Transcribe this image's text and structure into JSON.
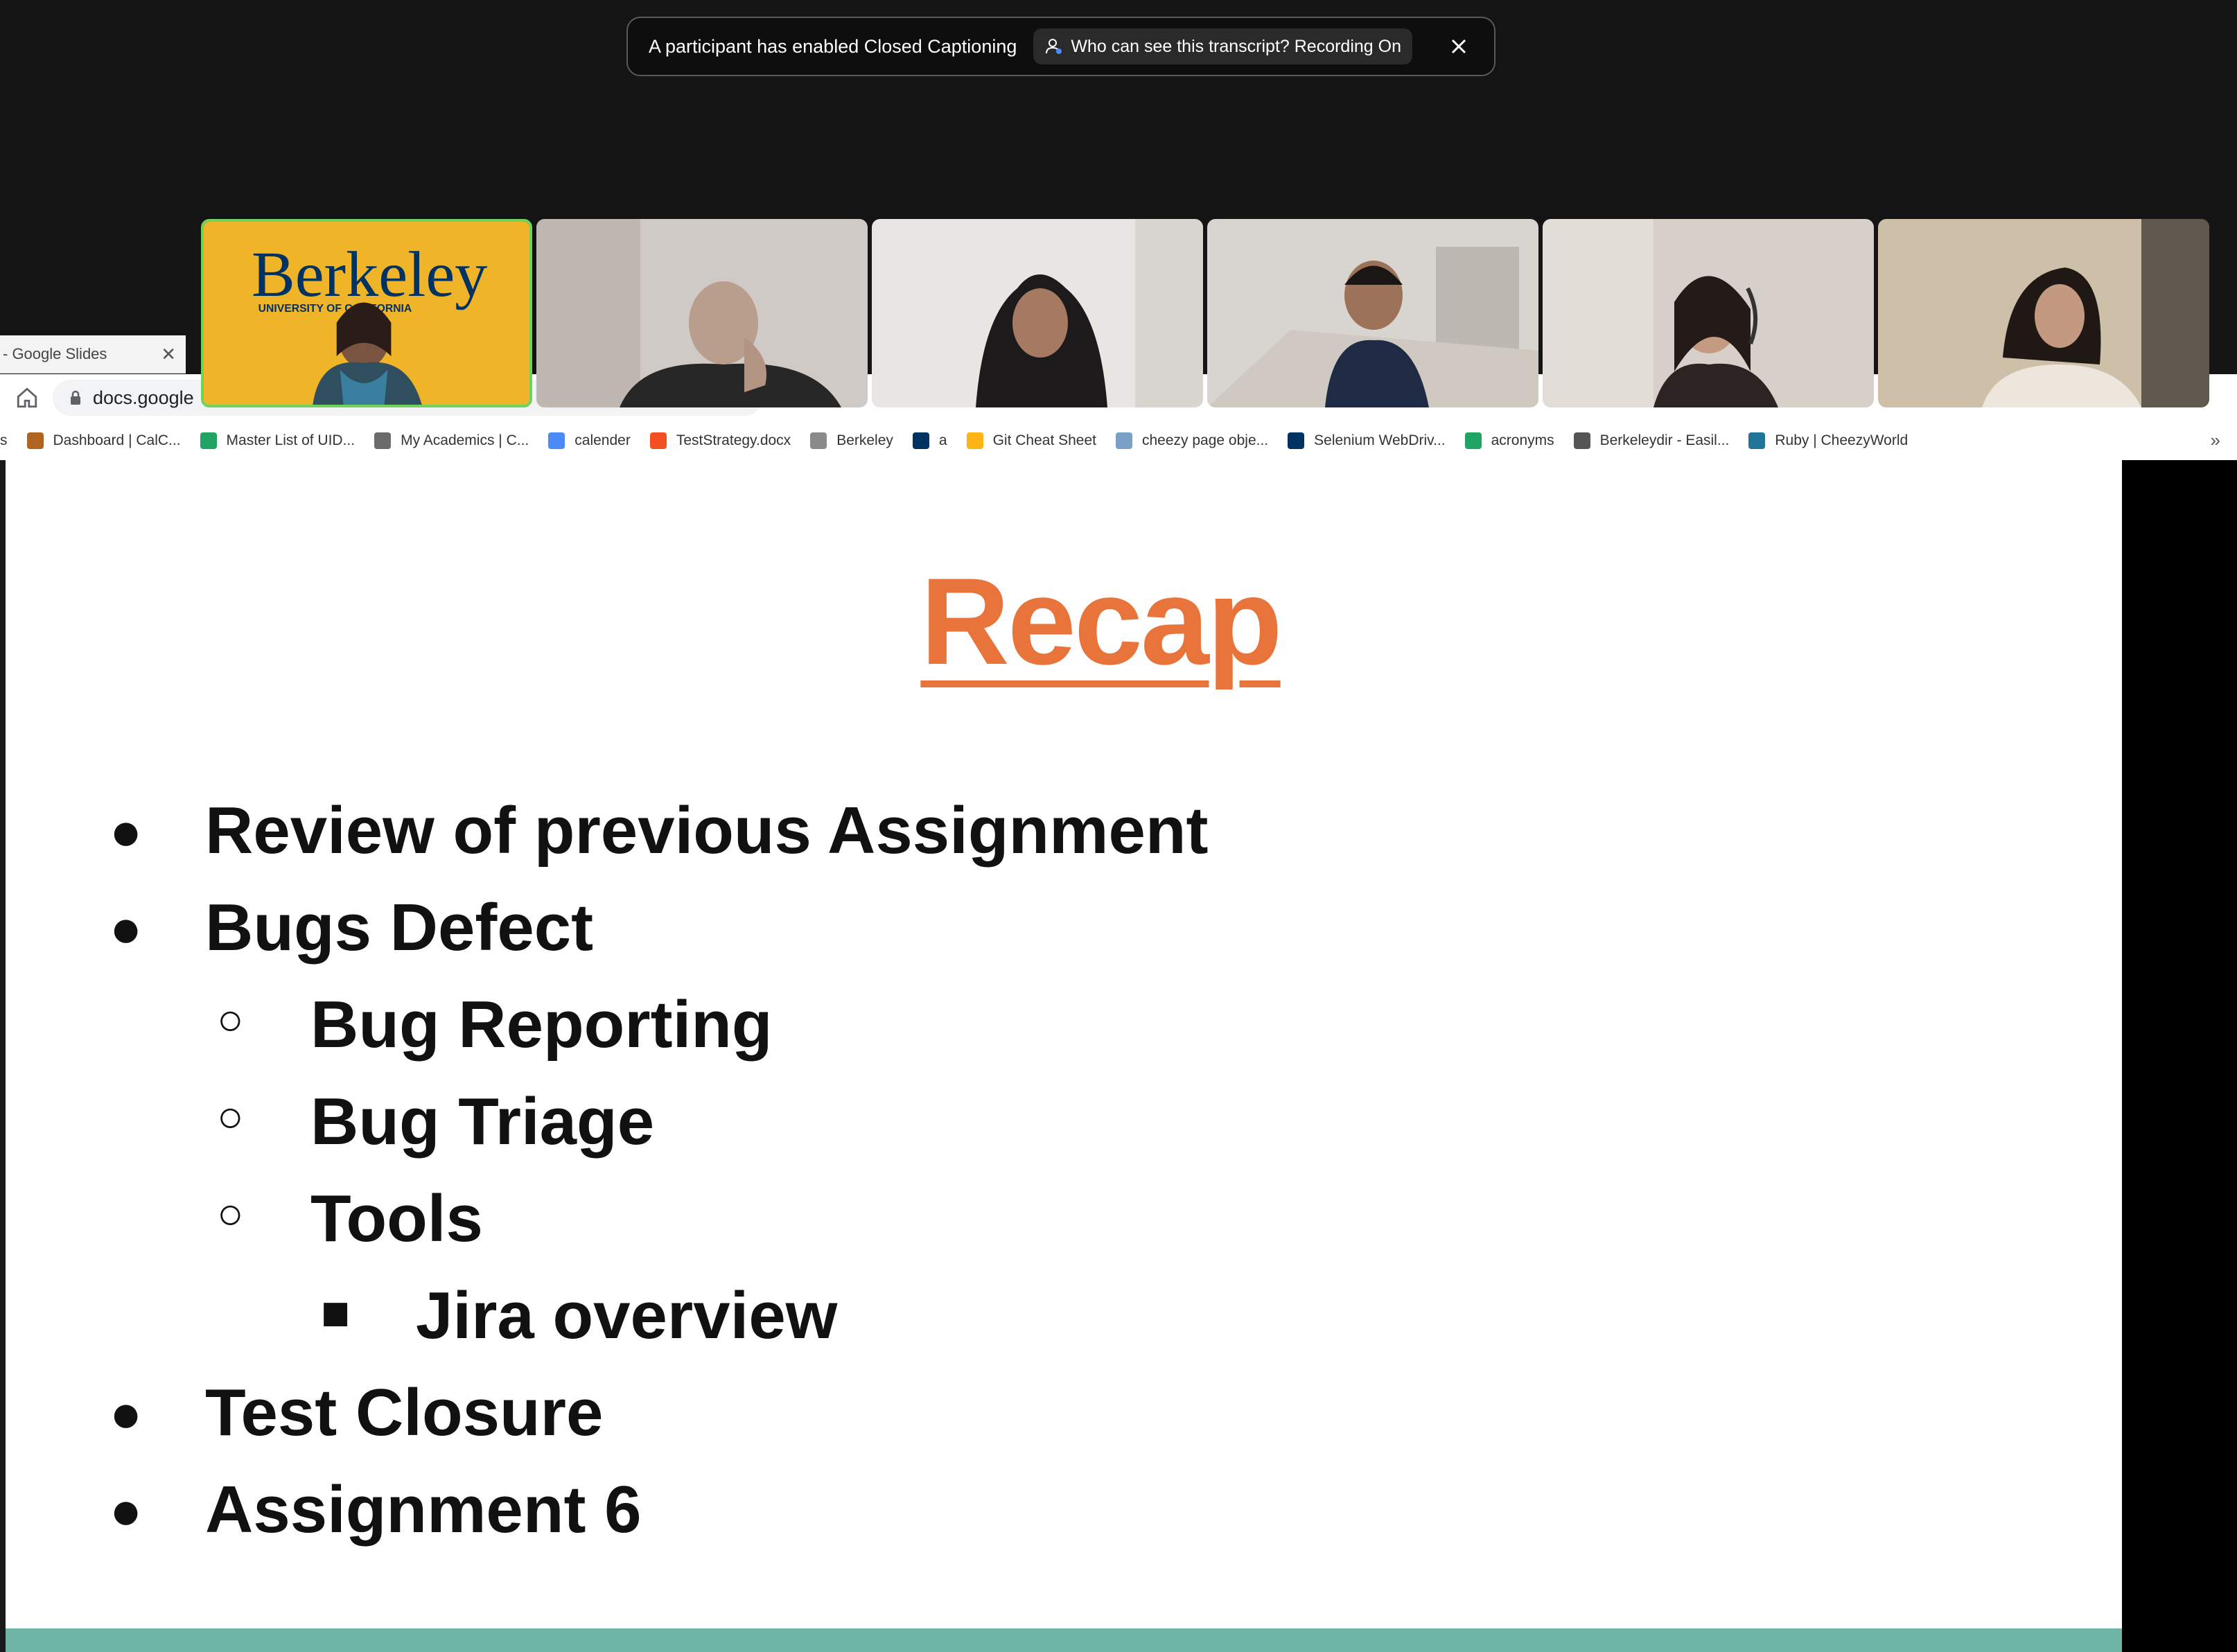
{
  "banner": {
    "message": "A participant has enabled Closed Captioning",
    "pill_text": "Who can see this transcript? Recording On"
  },
  "browser": {
    "tab_title": "- Google Slides",
    "url": "docs.google",
    "bookmarks": [
      {
        "label": "s",
        "color": ""
      },
      {
        "label": "Dashboard | CalC...",
        "color": "#b0641f"
      },
      {
        "label": "Master List of UID...",
        "color": "#1fa463"
      },
      {
        "label": "My Academics | C...",
        "color": "#6b6b6b"
      },
      {
        "label": "calender",
        "color": "#4c8bf5"
      },
      {
        "label": "TestStrategy.docx",
        "color": "#f25022"
      },
      {
        "label": "Berkeley",
        "color": "#8a8a8a"
      },
      {
        "label": "a",
        "color": "#003262"
      },
      {
        "label": "Git Cheat Sheet",
        "color": "#fdb515"
      },
      {
        "label": "cheezy page obje...",
        "color": "#7aa0c8"
      },
      {
        "label": "Selenium WebDriv...",
        "color": "#003262"
      },
      {
        "label": "acronyms",
        "color": "#1fa463"
      },
      {
        "label": "Berkeleydir - Easil...",
        "color": "#555555"
      },
      {
        "label": "Ruby | CheezyWorld",
        "color": "#21759b"
      }
    ],
    "more": "»"
  },
  "video": {
    "tiles": [
      {
        "name": "tile-1",
        "active": true
      },
      {
        "name": "tile-2",
        "active": false
      },
      {
        "name": "tile-3",
        "active": false
      },
      {
        "name": "tile-4",
        "active": false
      },
      {
        "name": "tile-5",
        "active": false
      },
      {
        "name": "tile-6",
        "active": false
      }
    ],
    "berkeley_logo": {
      "word": "Berkeley",
      "sub": "UNIVERSITY OF CALIFORNIA"
    }
  },
  "slide": {
    "title": "Recap",
    "items": [
      {
        "text": "Review of previous Assignment",
        "level": 1
      },
      {
        "text": "Bugs Defect",
        "level": 1
      },
      {
        "text": "Bug Reporting",
        "level": 2
      },
      {
        "text": "Bug Triage",
        "level": 2
      },
      {
        "text": "Tools",
        "level": 2
      },
      {
        "text": "Jira overview",
        "level": 3
      },
      {
        "text": "Test Closure",
        "level": 1
      },
      {
        "text": "Assignment 6",
        "level": 1
      }
    ],
    "bullets": {
      "1": "●",
      "2": "○",
      "3": "■"
    },
    "title_color": "#e8743b",
    "footer_color": "#6fb5a7"
  }
}
